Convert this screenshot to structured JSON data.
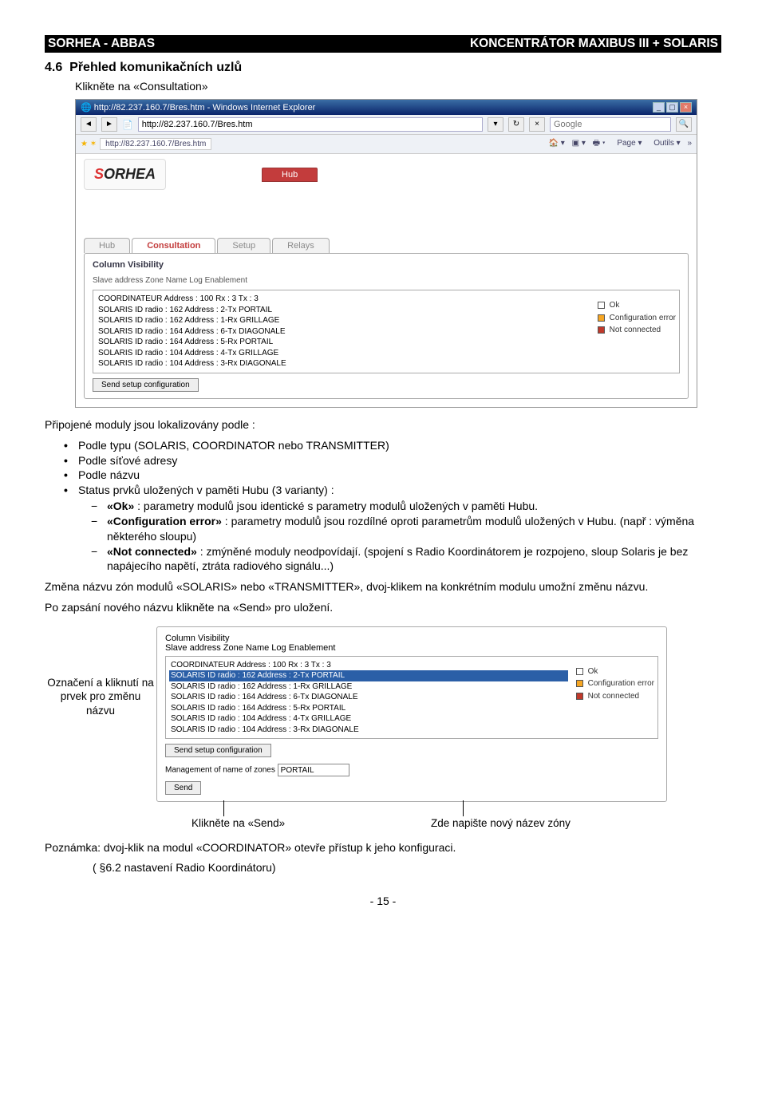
{
  "header": {
    "left": "SORHEA - ABBAS",
    "right": "KONCENTRÁTOR MAXIBUS III + SOLARIS"
  },
  "section": {
    "number": "4.6",
    "title": "Přehled komunikačních uzlů",
    "instruction": "Klikněte na «Consultation»"
  },
  "browser": {
    "titlebar": "http://82.237.160.7/Bres.htm - Windows Internet Explorer",
    "url": "http://82.237.160.7/Bres.htm",
    "tab": "http://82.237.160.7/Bres.htm",
    "search_placeholder": "Google",
    "toolbar": {
      "page": "Page",
      "outils": "Outils"
    }
  },
  "app": {
    "logo": "SORHEA",
    "hub": "Hub",
    "tabs": [
      "Hub",
      "Consultation",
      "Setup",
      "Relays"
    ],
    "panel_title": "Column Visibility",
    "subheader": "Slave address Zone Name Log Enablement",
    "rows1": [
      "COORDINATEUR Address : 100 Rx : 3 Tx : 3",
      "SOLARIS  ID radio : 162 Address :  2-Tx PORTAIL",
      "SOLARIS  ID radio : 162 Address :  1-Rx GRILLAGE",
      "SOLARIS  ID radio : 164 Address :  6-Tx DIAGONALE",
      "SOLARIS  ID radio : 164 Address :  5-Rx PORTAIL",
      "SOLARIS  ID radio : 104 Address :  4-Tx GRILLAGE",
      "SOLARIS  ID radio : 104 Address :  3-Rx DIAGONALE"
    ],
    "legend": {
      "ok": "Ok",
      "err": "Configuration error",
      "nc": "Not connected"
    },
    "send_config": "Send setup configuration",
    "mgmt_label": "Management of name of zones",
    "mgmt_value": "PORTAIL",
    "send": "Send"
  },
  "body": {
    "intro": "Připojené moduly jsou lokalizovány podle :",
    "bullets": [
      "Podle typu (SOLARIS, COORDINATOR nebo TRANSMITTER)",
      "Podle síťové adresy",
      "Podle názvu",
      "Status prvků uložených v paměti Hubu (3 varianty) :"
    ],
    "dashes": [
      {
        "b": "«Ok»",
        "t": " : parametry modulů jsou identické s parametry modulů uložených v paměti Hubu."
      },
      {
        "b": "«Configuration error»",
        "t": " : parametry modulů jsou rozdílné oproti parametrům modulů uložených v Hubu. (např : výměna některého sloupu)"
      },
      {
        "b": "«Not connected»",
        "t": " : zmýněné moduly neodpovídají. (spojení s Radio Koordinátorem je rozpojeno, sloup Solaris je bez napájecího napětí, ztráta radiového signálu...)"
      }
    ],
    "para1": "Změna názvu zón modulů «SOLARIS» nebo «TRANSMITTER», dvoj-klikem na konkrétním modulu umožní změnu názvu.",
    "para2": "Po zapsání nového názvu klikněte na «Send» pro uložení.",
    "callout_left": "Označení a kliknutí na prvek pro změnu názvu",
    "callout_b1": "Klikněte na «Send»",
    "callout_b2": "Zde napište nový název zóny",
    "note": "Poznámka: dvoj-klik na modul «COORDINATOR» otevře přístup k jeho konfiguraci.",
    "note_sub": "( §6.2 nastavení Radio Koordinátoru)"
  },
  "footer": "- 15 -"
}
